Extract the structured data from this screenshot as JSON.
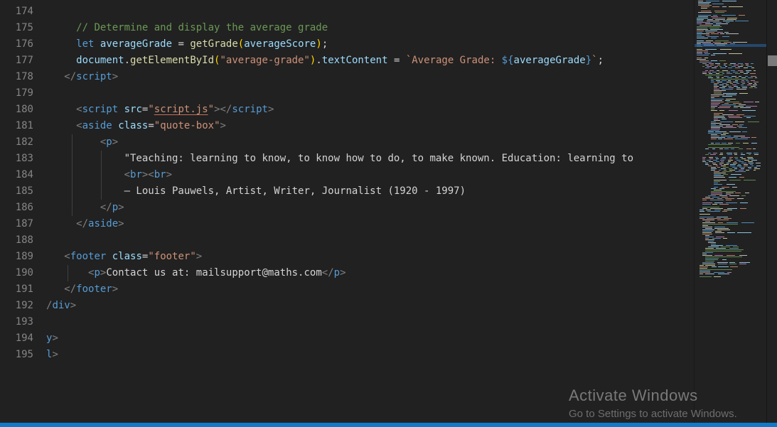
{
  "editor": {
    "lines": [
      {
        "num": "174",
        "tokens": []
      },
      {
        "num": "175",
        "tokens": [
          [
            "ws",
            "     "
          ],
          [
            "cm",
            "// Determine and display the average grade"
          ]
        ]
      },
      {
        "num": "176",
        "tokens": [
          [
            "ws",
            "     "
          ],
          [
            "kw",
            "let"
          ],
          [
            "pl",
            " "
          ],
          [
            "var",
            "averageGrade"
          ],
          [
            "pl",
            " = "
          ],
          [
            "fn",
            "getGrade"
          ],
          [
            "gold",
            "("
          ],
          [
            "var",
            "averageScore"
          ],
          [
            "gold",
            ")"
          ],
          [
            "pl",
            ";"
          ]
        ]
      },
      {
        "num": "177",
        "tokens": [
          [
            "ws",
            "     "
          ],
          [
            "var",
            "document"
          ],
          [
            "pl",
            "."
          ],
          [
            "fn",
            "getElementById"
          ],
          [
            "gold",
            "("
          ],
          [
            "str",
            "\"average-grade\""
          ],
          [
            "gold",
            ")"
          ],
          [
            "pl",
            "."
          ],
          [
            "var",
            "textContent"
          ],
          [
            "pl",
            " = "
          ],
          [
            "str",
            "`Average Grade: "
          ],
          [
            "kw",
            "${"
          ],
          [
            "var",
            "averageGrade"
          ],
          [
            "kw",
            "}"
          ],
          [
            "str",
            "`"
          ],
          [
            "pl",
            ";"
          ]
        ]
      },
      {
        "num": "178",
        "tokens": [
          [
            "ws",
            "   "
          ],
          [
            "pn",
            "</"
          ],
          [
            "tag",
            "script"
          ],
          [
            "pn",
            ">"
          ]
        ]
      },
      {
        "num": "179",
        "tokens": []
      },
      {
        "num": "180",
        "tokens": [
          [
            "ws",
            "     "
          ],
          [
            "pn",
            "<"
          ],
          [
            "tag",
            "script"
          ],
          [
            "pl",
            " "
          ],
          [
            "attr",
            "src"
          ],
          [
            "pl",
            "="
          ],
          [
            "str",
            "\""
          ],
          [
            "stru",
            "script.js"
          ],
          [
            "str",
            "\""
          ],
          [
            "pn",
            "></"
          ],
          [
            "tag",
            "script"
          ],
          [
            "pn",
            ">"
          ]
        ]
      },
      {
        "num": "181",
        "tokens": [
          [
            "ws",
            "     "
          ],
          [
            "pn",
            "<"
          ],
          [
            "tag",
            "aside"
          ],
          [
            "pl",
            " "
          ],
          [
            "attr",
            "class"
          ],
          [
            "pl",
            "="
          ],
          [
            "str",
            "\"quote-box\""
          ],
          [
            "pn",
            ">"
          ]
        ]
      },
      {
        "num": "182",
        "tokens": [
          [
            "ws",
            "         "
          ],
          [
            "pn",
            "<"
          ],
          [
            "tag",
            "p"
          ],
          [
            "pn",
            ">"
          ]
        ]
      },
      {
        "num": "183",
        "tokens": [
          [
            "ws",
            "             "
          ],
          [
            "pl",
            "\"Teaching: learning to know, to know how to do, to make known. Education: learning to "
          ]
        ]
      },
      {
        "num": "184",
        "tokens": [
          [
            "ws",
            "             "
          ],
          [
            "pn",
            "<"
          ],
          [
            "tag",
            "br"
          ],
          [
            "pn",
            "><"
          ],
          [
            "tag",
            "br"
          ],
          [
            "pn",
            ">"
          ]
        ]
      },
      {
        "num": "185",
        "tokens": [
          [
            "ws",
            "             "
          ],
          [
            "pl",
            "— Louis Pauwels, Artist, Writer, Journalist (1920 - 1997)"
          ]
        ]
      },
      {
        "num": "186",
        "tokens": [
          [
            "ws",
            "         "
          ],
          [
            "pn",
            "</"
          ],
          [
            "tag",
            "p"
          ],
          [
            "pn",
            ">"
          ]
        ]
      },
      {
        "num": "187",
        "tokens": [
          [
            "ws",
            "     "
          ],
          [
            "pn",
            "</"
          ],
          [
            "tag",
            "aside"
          ],
          [
            "pn",
            ">"
          ]
        ]
      },
      {
        "num": "188",
        "tokens": []
      },
      {
        "num": "189",
        "tokens": [
          [
            "ws",
            "   "
          ],
          [
            "pn",
            "<"
          ],
          [
            "tag",
            "footer"
          ],
          [
            "pl",
            " "
          ],
          [
            "attr",
            "class"
          ],
          [
            "pl",
            "="
          ],
          [
            "str",
            "\"footer\""
          ],
          [
            "pn",
            ">"
          ]
        ]
      },
      {
        "num": "190",
        "tokens": [
          [
            "ws",
            "       "
          ],
          [
            "pn",
            "<"
          ],
          [
            "tag",
            "p"
          ],
          [
            "pn",
            ">"
          ],
          [
            "pl",
            "Contact us at: mailsupport@maths.com"
          ],
          [
            "pn",
            "</"
          ],
          [
            "tag",
            "p"
          ],
          [
            "pn",
            ">"
          ]
        ]
      },
      {
        "num": "191",
        "tokens": [
          [
            "ws",
            "   "
          ],
          [
            "pn",
            "</"
          ],
          [
            "tag",
            "footer"
          ],
          [
            "pn",
            ">"
          ]
        ]
      },
      {
        "num": "192",
        "tokens": [
          [
            "pn",
            "/"
          ],
          [
            "tag",
            "div"
          ],
          [
            "pn",
            ">"
          ]
        ]
      },
      {
        "num": "193",
        "tokens": []
      },
      {
        "num": "194",
        "tokens": [
          [
            "tag",
            "y"
          ],
          [
            "pn",
            ">"
          ]
        ]
      },
      {
        "num": "195",
        "tokens": [
          [
            "tag",
            "l"
          ],
          [
            "pn",
            ">"
          ]
        ]
      }
    ]
  },
  "minimap": {
    "total_lines": 195,
    "palette": [
      "#569cd6",
      "#9cdcfe",
      "#ce9178",
      "#6a9955",
      "#dcdcaa",
      "#c586c0",
      "#d4d4d4",
      "#808080"
    ],
    "highlight_color": "#2a67ad"
  },
  "watermark": {
    "title": "Activate Windows",
    "subtitle": "Go to Settings to activate Windows."
  },
  "colors": {
    "background": "#212121",
    "line_number": "#858585",
    "comment": "#6a9955",
    "keyword_tag": "#569cd6",
    "variable_attr": "#9cdcfe",
    "function": "#dcdcaa",
    "string": "#ce9178",
    "plain_text": "#d4d4d4",
    "punctuation": "#808080",
    "bracket_gold": "#ffd700",
    "indent_guide": "#404040",
    "status_bar": "#0f7ac9",
    "scrollbar_thumb": "#7b7b7b",
    "watermark_text": "#797979"
  }
}
